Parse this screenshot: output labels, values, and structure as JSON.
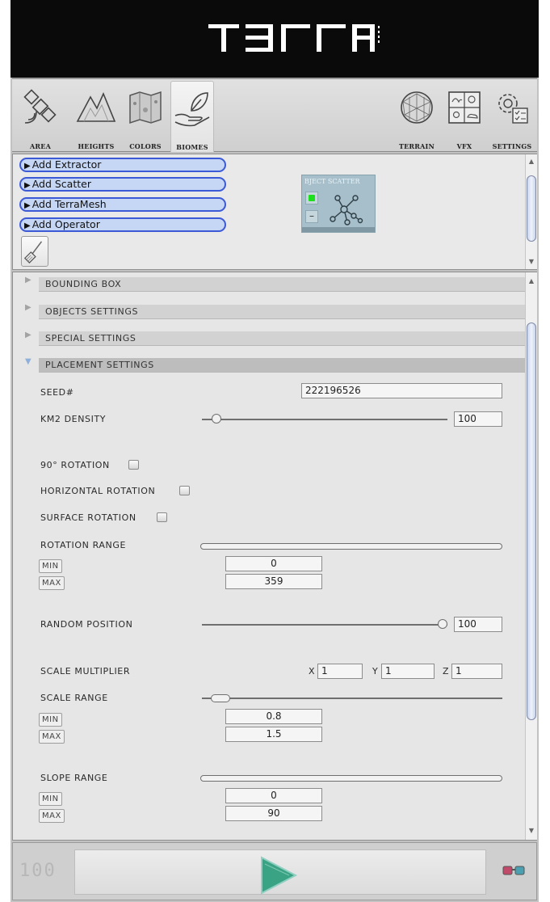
{
  "app": {
    "logo_text": "TERRA",
    "logo_sub": "UNITY"
  },
  "toolbar": {
    "tools": [
      {
        "label": "AREA",
        "icon": "satellite-icon"
      },
      {
        "label": "HEIGHTS",
        "icon": "mountain-icon"
      },
      {
        "label": "COLORS",
        "icon": "texture-map-icon"
      },
      {
        "label": "BIOMES",
        "icon": "leaf-hand-icon",
        "active": true
      },
      {
        "label": "TERRAIN",
        "icon": "globe-mesh-icon"
      },
      {
        "label": "VFX",
        "icon": "weather-grid-icon"
      },
      {
        "label": "SETTINGS",
        "icon": "gear-checklist-icon"
      }
    ]
  },
  "nodes": {
    "add_buttons": [
      "Add Extractor",
      "Add Scatter",
      "Add TerraMesh",
      "Add Operator"
    ],
    "scatter_node_title": "BJECT SCATTER",
    "scatter_minus": "–"
  },
  "sections": [
    {
      "label": "BOUNDING BOX",
      "open": false
    },
    {
      "label": "OBJECTS SETTINGS",
      "open": false
    },
    {
      "label": "SPECIAL SETTINGS",
      "open": false
    },
    {
      "label": "PLACEMENT SETTINGS",
      "open": true
    }
  ],
  "placement": {
    "seed_label": "SEED#",
    "seed_value": "222196526",
    "density_label": "KM2 DENSITY",
    "density_value": "100",
    "density_slider_fraction": 0.04,
    "rotation90_label": "90° ROTATION",
    "horizontal_rotation_label": "HORIZONTAL ROTATION",
    "surface_rotation_label": "SURFACE ROTATION",
    "rotation_range": {
      "label": "ROTATION RANGE",
      "min_label": "MIN",
      "max_label": "MAX",
      "min": "0",
      "max": "359"
    },
    "random_position": {
      "label": "RANDOM POSITION",
      "value": "100",
      "slider_fraction": 1.0
    },
    "scale_multiplier": {
      "label": "SCALE MULTIPLIER",
      "x_label": "X",
      "y_label": "Y",
      "z_label": "Z",
      "x": "1",
      "y": "1",
      "z": "1"
    },
    "scale_range": {
      "label": "SCALE RANGE",
      "min_label": "MIN",
      "max_label": "MAX",
      "min": "0.8",
      "max": "1.5"
    },
    "slope_range": {
      "label": "SLOPE RANGE",
      "min_label": "MIN",
      "max_label": "MAX",
      "min": "0",
      "max": "90"
    }
  },
  "footer": {
    "counter": "100"
  },
  "colors": {
    "accent_blue": "#3d5ad6",
    "play_green": "#3aa383",
    "node_blue": "#a6bfcb"
  }
}
